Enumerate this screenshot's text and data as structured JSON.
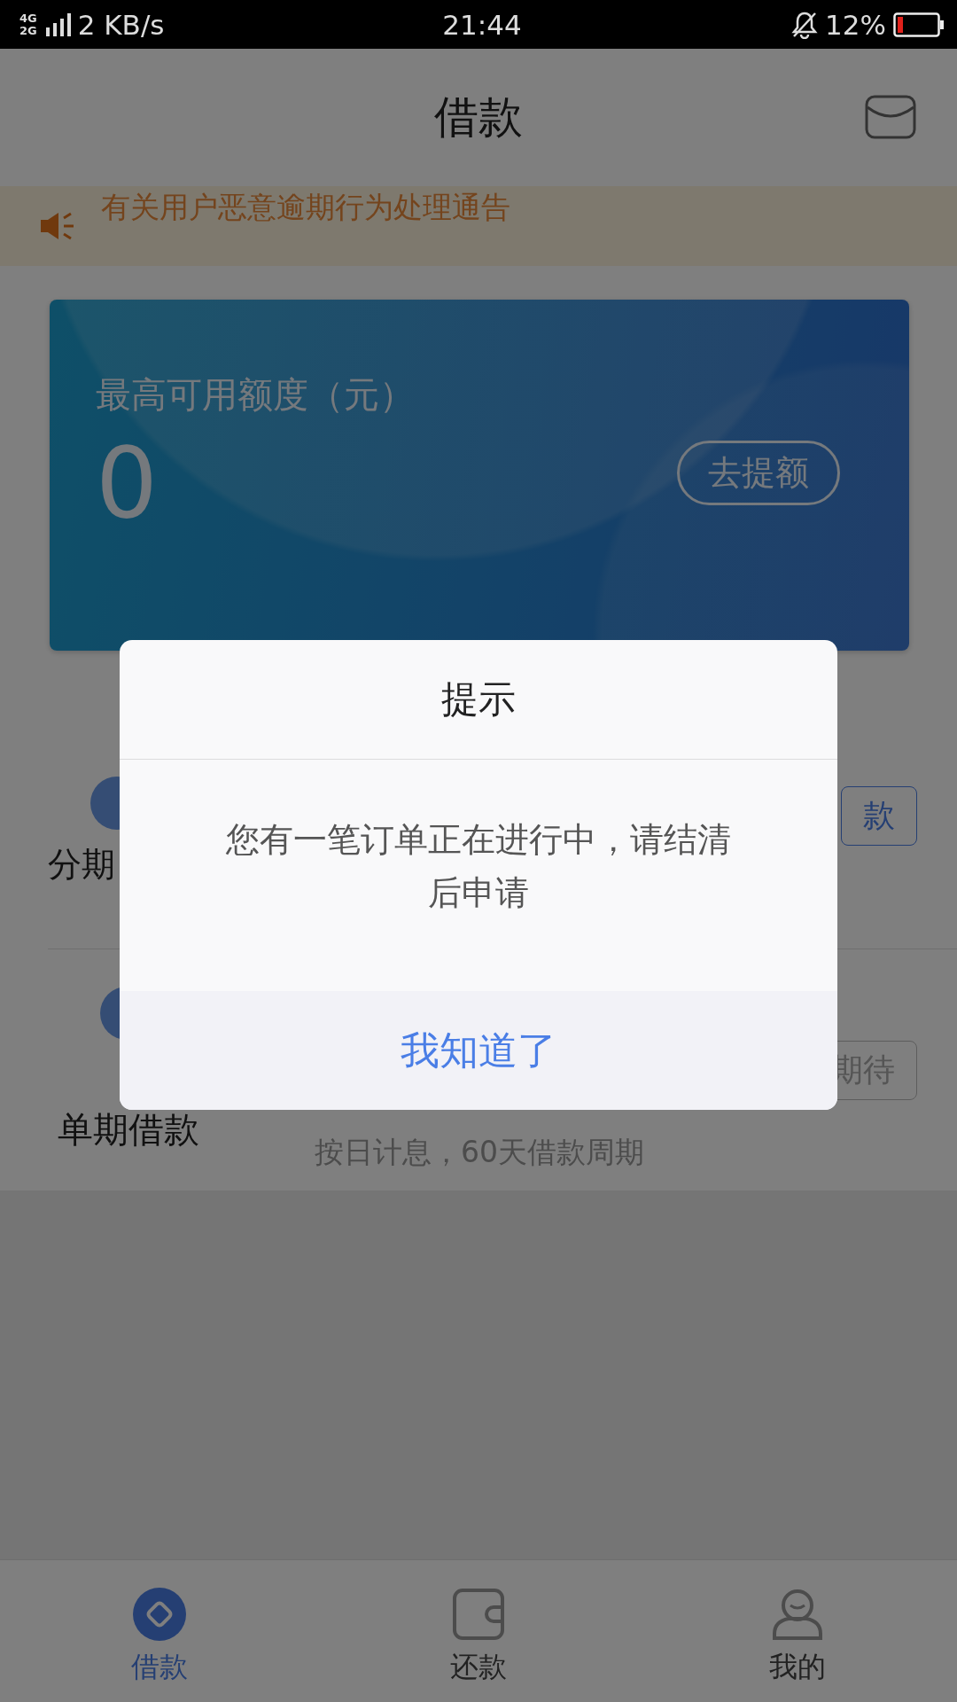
{
  "status_bar": {
    "network_top": "4G",
    "network_bottom": "2G",
    "speed": "2 KB/s",
    "time": "21:44",
    "battery": "12%"
  },
  "header": {
    "title": "借款"
  },
  "notice": {
    "text": "有关用户恶意逾期行为处理通告"
  },
  "credit_card": {
    "label": "最高可用额度（元）",
    "amount": "0",
    "button": "去提额"
  },
  "products": [
    {
      "title": "分期",
      "button": "款",
      "kind": "active"
    },
    {
      "title": "单期借款",
      "subtitle": "按日计息，60天借款周期",
      "button": "期待",
      "kind": "disabled"
    }
  ],
  "dialog": {
    "title": "提示",
    "message": "您有一笔订单正在进行中，请结清后申请",
    "button": "我知道了"
  },
  "bottom_nav": [
    {
      "label": "借款",
      "kind": "diamond",
      "selected": true
    },
    {
      "label": "还款",
      "kind": "wallet",
      "selected": false
    },
    {
      "label": "我的",
      "kind": "person",
      "selected": false
    }
  ]
}
